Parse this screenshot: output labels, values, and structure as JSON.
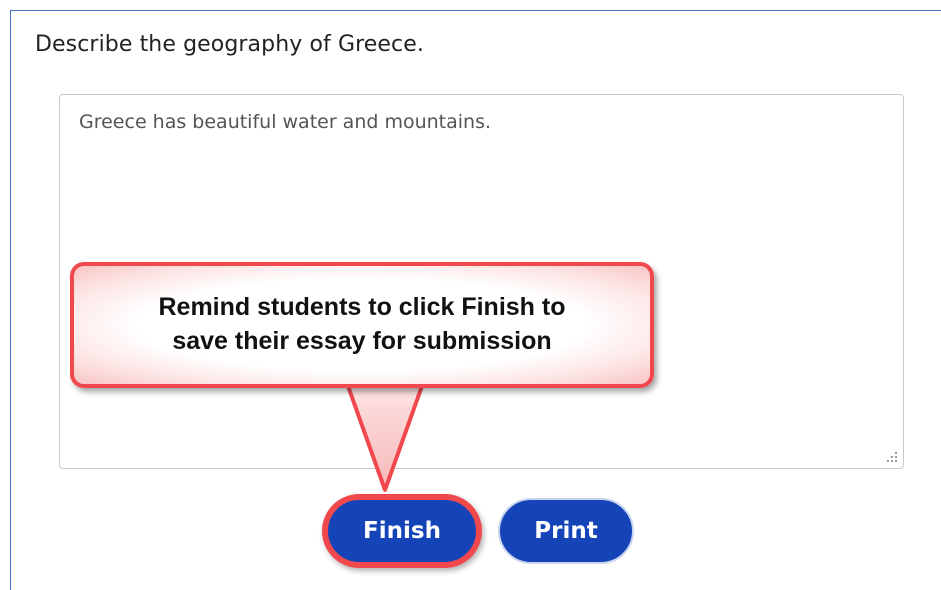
{
  "question": {
    "text": "Describe the geography of Greece."
  },
  "essay": {
    "value": "Greece has beautiful water and mountains."
  },
  "callout": {
    "line1": "Remind students to click Finish to",
    "line2": "save their essay for submission"
  },
  "buttons": {
    "finish_label": "Finish",
    "print_label": "Print"
  },
  "colors": {
    "button_blue": "#1444b8",
    "callout_red": "#f0484d",
    "frame_border": "#4a6fbf"
  }
}
